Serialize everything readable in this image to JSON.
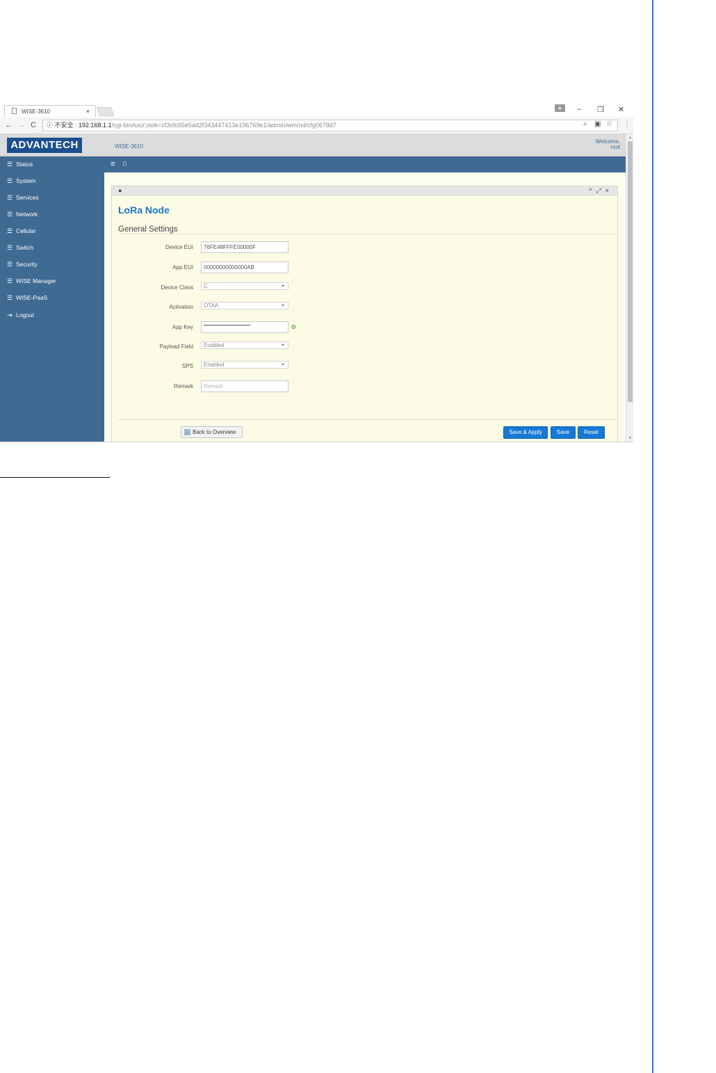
{
  "browser": {
    "tab_title": "WISE-3610",
    "tab_close": "×",
    "security_label": "不安全",
    "url_host": "192.168.1.1",
    "url_path": "/cgi-bin/luci/;stok=cf3cfc65e5ad2f343447413e196769e1/admin/wm/nd/cfg0678d7",
    "window_controls": {
      "minimize": "–",
      "restore": "❐",
      "close": "✕"
    }
  },
  "header": {
    "logo": "ADVANTECH",
    "product": "WISE-3610",
    "welcome": "Welcome,",
    "user": "root"
  },
  "sidebar": {
    "items": [
      {
        "label": "Status",
        "icon": "list-icon"
      },
      {
        "label": "System",
        "icon": "list-icon"
      },
      {
        "label": "Services",
        "icon": "list-icon"
      },
      {
        "label": "Network",
        "icon": "list-icon"
      },
      {
        "label": "Cellular",
        "icon": "list-icon"
      },
      {
        "label": "Switch",
        "icon": "list-icon"
      },
      {
        "label": "Security",
        "icon": "list-icon"
      },
      {
        "label": "WISE Manager",
        "icon": "list-icon"
      },
      {
        "label": "WISE-PaaS",
        "icon": "list-icon"
      },
      {
        "label": "Logout",
        "icon": "logout-icon"
      }
    ]
  },
  "page": {
    "title": "LoRa Node",
    "section": "General Settings",
    "fields": {
      "device_eui": {
        "label": "Device EUI",
        "value": "76FE48FFFE00000F"
      },
      "app_eui": {
        "label": "App EUI",
        "value": "00000000000000AB"
      },
      "device_class": {
        "label": "Device Class",
        "value": "C"
      },
      "activation": {
        "label": "Activation",
        "value": "OTAA"
      },
      "app_key": {
        "label": "App Key",
        "value": "••••••••••••••••••••••••••••••••"
      },
      "payload_field": {
        "label": "Payload Field",
        "value": "Enabled"
      },
      "sps": {
        "label": "SPS",
        "value": "Enabled"
      },
      "remark": {
        "label": "Remark",
        "placeholder": "Remark"
      }
    },
    "buttons": {
      "back": "Back to Overview",
      "save_apply": "Save & Apply",
      "save": "Save",
      "reset": "Reset"
    }
  },
  "colors": {
    "sidebar": "#3f6a92",
    "accent": "#1779d4",
    "title": "#1c74d0",
    "content_bg": "#fdfdef",
    "page_rule": "#2c6fd6"
  }
}
